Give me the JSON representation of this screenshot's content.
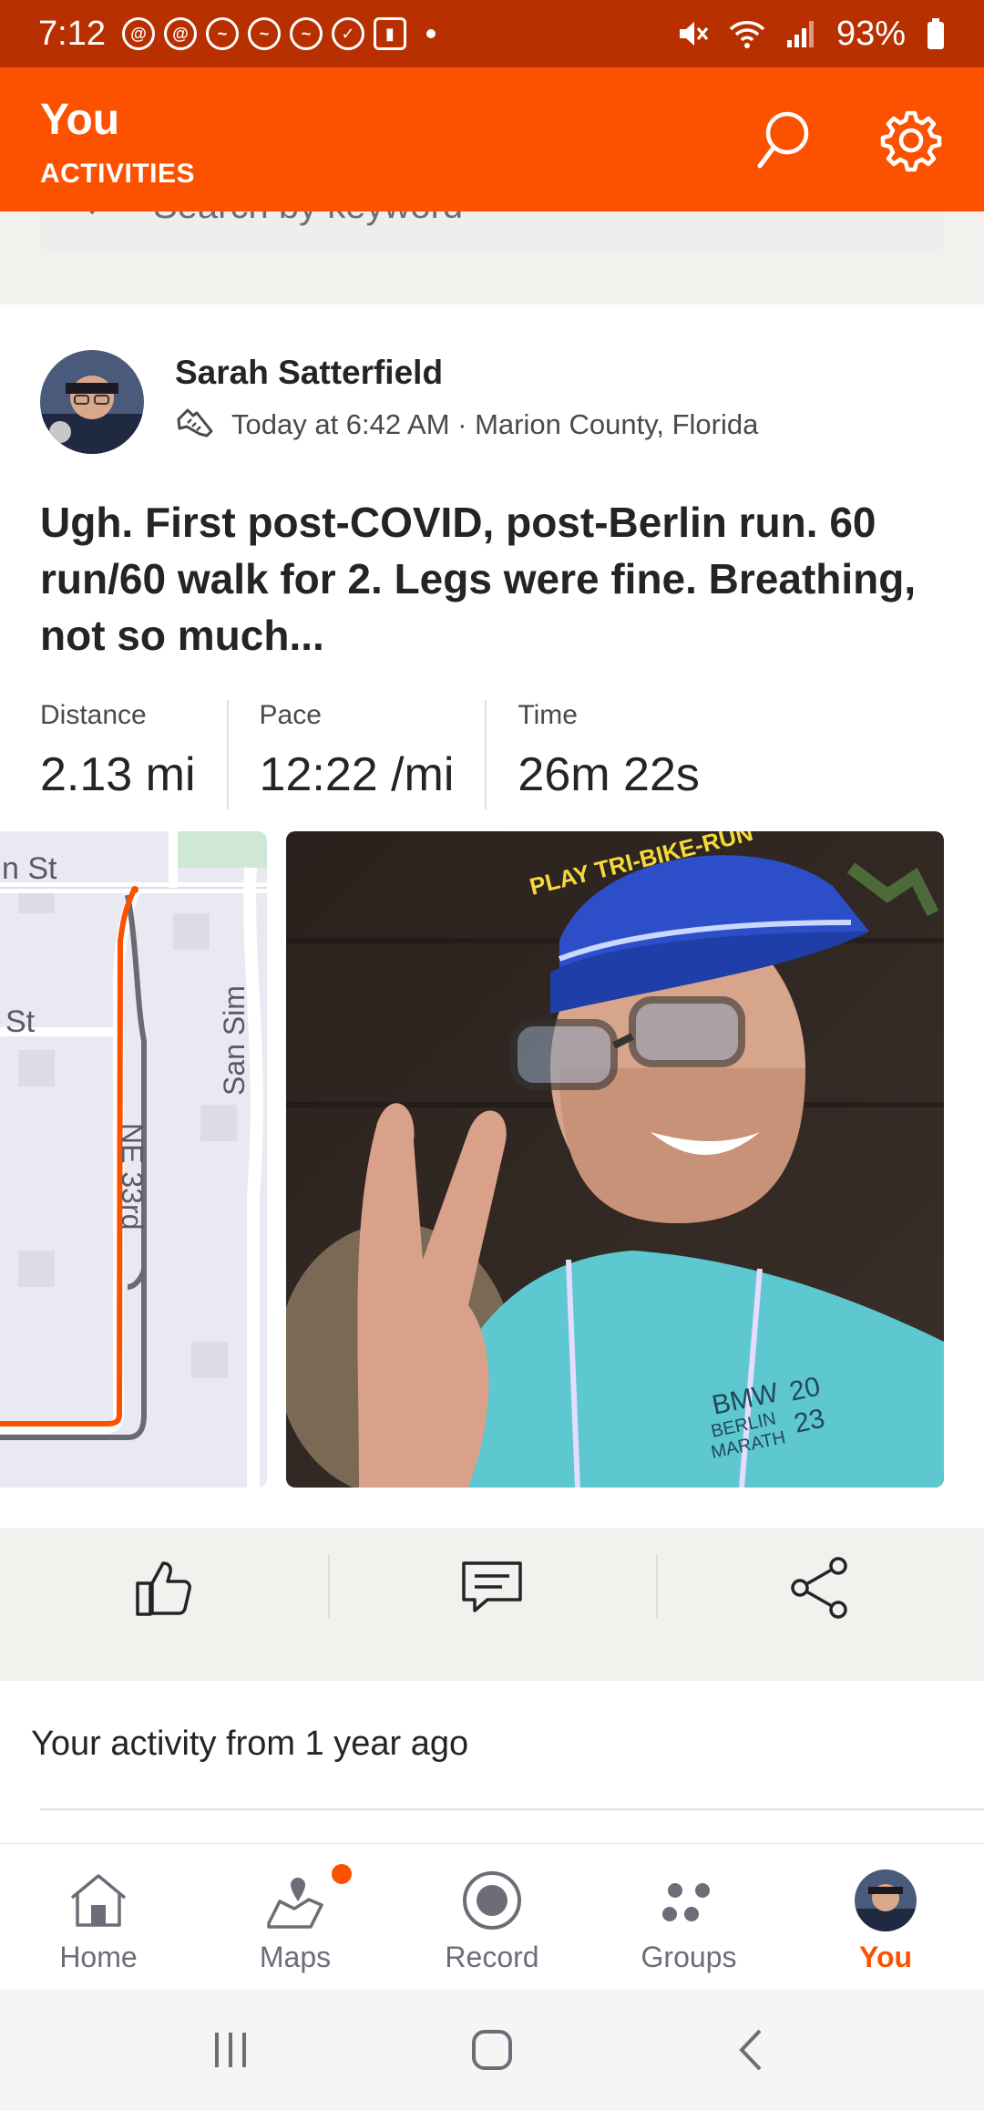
{
  "status_bar": {
    "time": "7:12",
    "battery": "93%"
  },
  "header": {
    "title": "You",
    "subtitle": "ACTIVITIES"
  },
  "search": {
    "placeholder": "Search by keyword"
  },
  "activity": {
    "athlete": "Sarah Satterfield",
    "meta": "Today at 6:42 AM · Marion County, Florida",
    "title": "Ugh.  First post-COVID, post-Berlin run.  60 run/60 walk for 2.  Legs were fine. Breathing, not so much...",
    "stats": [
      {
        "label": "Distance",
        "value": "2.13 mi"
      },
      {
        "label": "Pace",
        "value": "12:22 /mi"
      },
      {
        "label": "Time",
        "value": "26m 22s"
      }
    ],
    "map_labels": {
      "street_1": "n St",
      "street_2": "St",
      "street_3": "San Sim",
      "street_4": "NE 33rd"
    },
    "photo_text": {
      "cap": "PLAY TRI-BIKE-RUN",
      "shirt_1": "BMW",
      "shirt_2": "BERLIN",
      "shirt_3": "MARATH",
      "shirt_year_1": "20",
      "shirt_year_2": "23"
    }
  },
  "memory": {
    "text": "Your activity from 1 year ago"
  },
  "bottom_nav": [
    {
      "label": "Home",
      "icon": "home-icon"
    },
    {
      "label": "Maps",
      "icon": "maps-icon"
    },
    {
      "label": "Record",
      "icon": "record-icon"
    },
    {
      "label": "Groups",
      "icon": "groups-icon"
    },
    {
      "label": "You",
      "icon": "avatar"
    }
  ],
  "colors": {
    "brand": "#fc5200",
    "status_bar": "#b83000"
  }
}
